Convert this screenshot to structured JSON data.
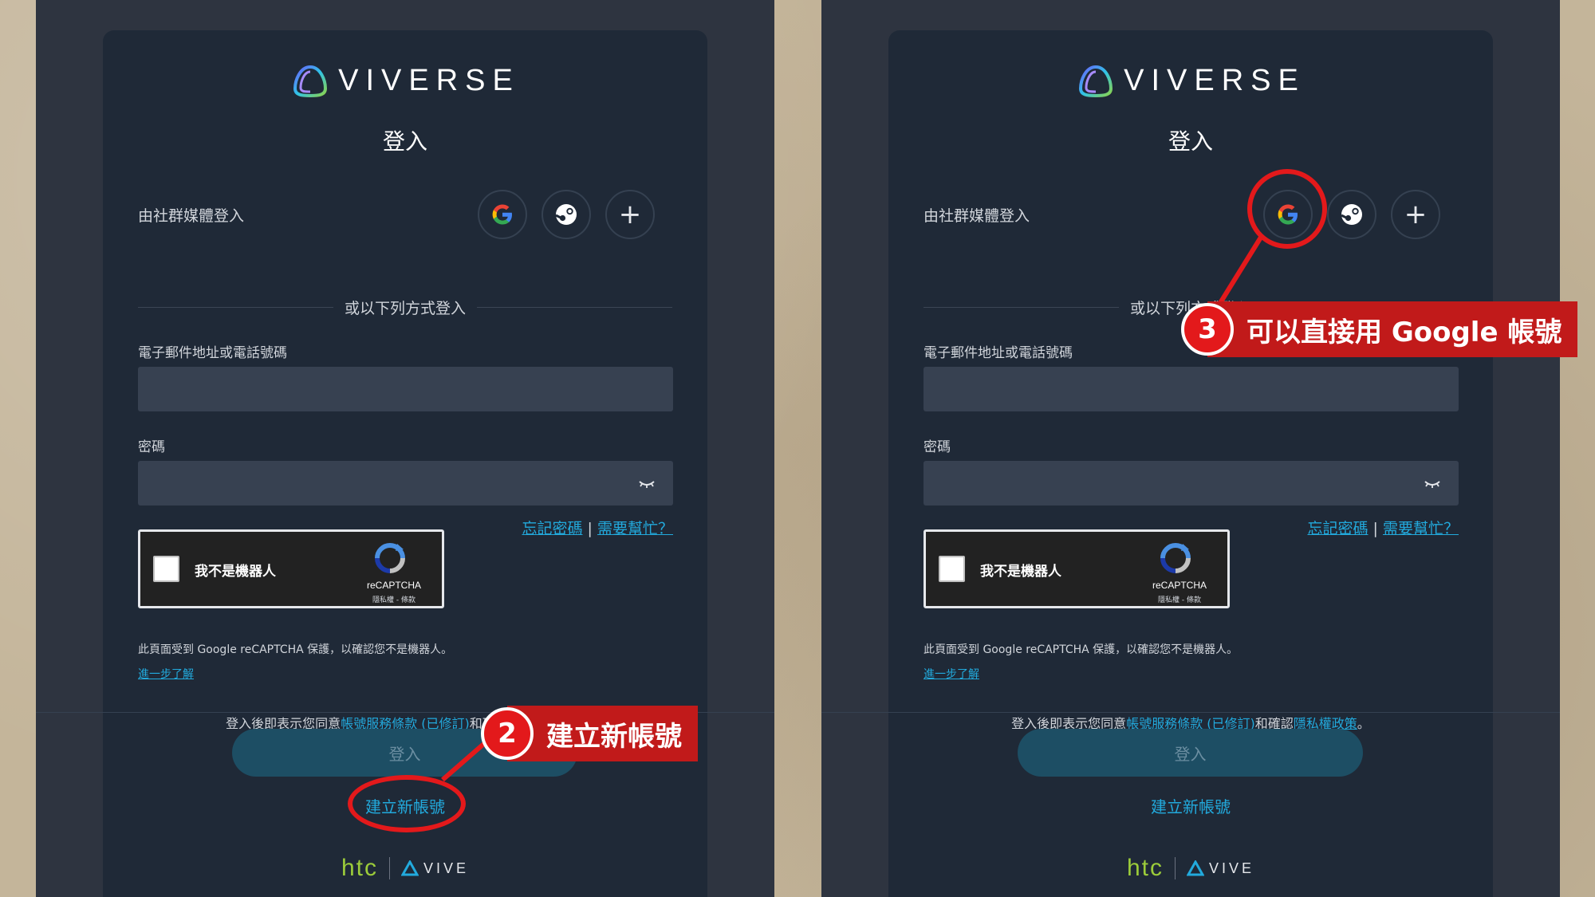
{
  "brand": {
    "logo_text": "VIVERSE",
    "footer_htc": "htc",
    "footer_vive": "VIVE"
  },
  "login": {
    "title": "登入",
    "social_label": "由社群媒體登入",
    "social_buttons": [
      "google-icon",
      "steam-icon",
      "plus-icon"
    ],
    "divider_text": "或以下列方式登入",
    "email_label": "電子郵件地址或電話號碼",
    "email_value": "",
    "password_label": "密碼",
    "password_value": "",
    "forgot_password": "忘記密碼",
    "links_separator": "|",
    "need_help": "需要幫忙？",
    "captcha_label": "我不是機器人",
    "captcha_brand": "reCAPTCHA",
    "captcha_terms": "隱私權 - 條款",
    "captcha_note": "此頁面受到 Google reCAPTCHA 保護，以確認您不是機器人。",
    "learn_more": "進一步了解",
    "terms_prefix": "登入後即表示您同意",
    "terms_link": "帳號服務條款 (已修訂)",
    "terms_middle": "和確認",
    "privacy_link": "隱私權政策",
    "terms_suffix": "。",
    "login_button": "登入",
    "create_account": "建立新帳號"
  },
  "annotations": {
    "step2_number": "2",
    "step2_text": "建立新帳號",
    "step3_number": "3",
    "step3_text": "可以直接用 Google 帳號"
  },
  "colors": {
    "accent_link": "#22aadd",
    "annotation_red": "#e3191b",
    "card_bg": "#1f2937",
    "panel_bg": "#2e3440"
  }
}
